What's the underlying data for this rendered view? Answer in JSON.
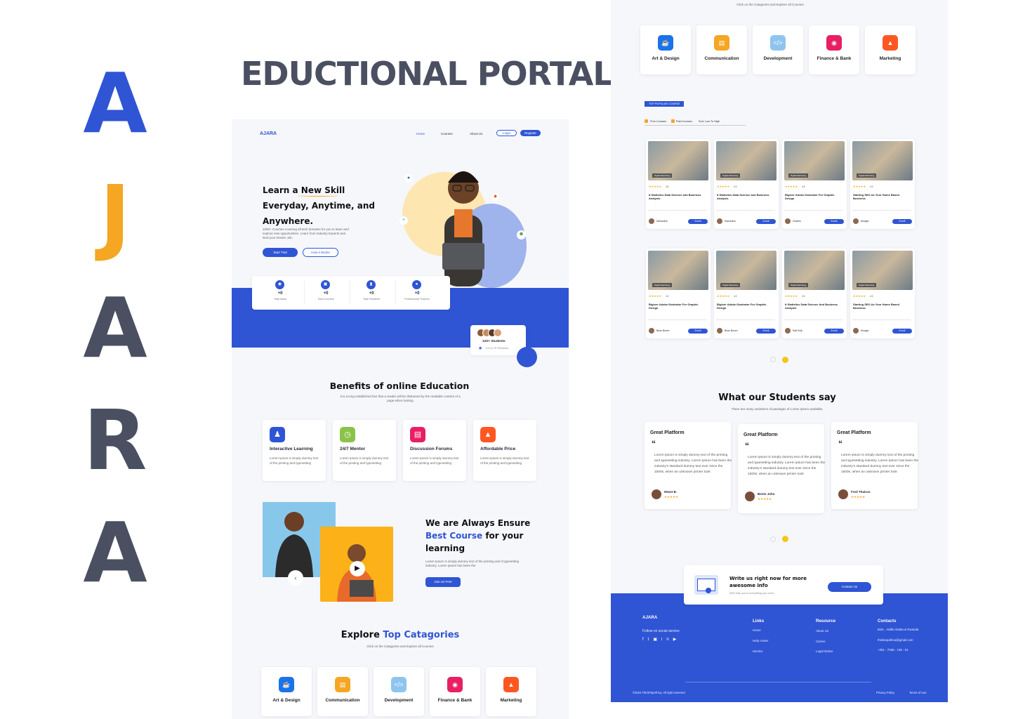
{
  "brand_letters": [
    "A",
    "J",
    "A",
    "R",
    "A"
  ],
  "page_title": "EDUCTIONAL PORTAL",
  "nav": {
    "logo": "AJARA",
    "home": "Home",
    "courses": "Courses",
    "about": "About Us",
    "login": "Login",
    "register": "Register"
  },
  "hero": {
    "headline": [
      "Learn a New Skill",
      "Everyday, Anytime, and",
      "Anywhere."
    ],
    "desc": "1000+ Courses covering all tech domains for you to learn and explore new opportunities. Learn from Industry Experts and land your Dream Job.",
    "start_trial": "Start Trial",
    "how_it_works": "How it Works",
    "stats": [
      {
        "value": "+0",
        "label": "Total Ideas"
      },
      {
        "value": "+0",
        "label": "Total Courses"
      },
      {
        "value": "+0",
        "label": "Total Students"
      },
      {
        "value": "+0",
        "label": "Professional Trainers"
      }
    ],
    "students_badge": {
      "count": "120+ Students",
      "rating": "5.0 (4.7K Reviews)"
    }
  },
  "benefits": {
    "title": "Benefits of online Education",
    "subtitle": "It is a long established fact that a reader will be distracted by the readable content of a page when looking",
    "items": [
      {
        "title": "Interactive Learning",
        "desc": "Lorem Ipsum is simply dummy text of the printing and typesetting",
        "color": "#2f55d4"
      },
      {
        "title": "24/7 Mentor",
        "desc": "Lorem Ipsum is simply dummy text of the printing and typesetting",
        "color": "#8bc34a"
      },
      {
        "title": "Discussion Forums",
        "desc": "Lorem Ipsum is simply dummy text of the printing and typesetting",
        "color": "#e91e63"
      },
      {
        "title": "Affordable Price",
        "desc": "Lorem Ipsum is simply dummy text of the printing and typesetting",
        "color": "#ff5722"
      }
    ]
  },
  "ensure": {
    "line1": "We are Always Ensure",
    "highlight": "Best Course",
    "line2": " for your",
    "line3": "learning",
    "desc": "Lorem Ipsum is simply dummy text of the printing and it typesetting industry. Lorem Ipsum has been the",
    "button": "Join Us Free"
  },
  "categories": {
    "title_a": "Explore ",
    "title_b": "Top Catagories",
    "subtitle": "Click on the Catagories and Explore all Courses",
    "items": [
      {
        "label": "Art & Design",
        "color": "#1a73e8",
        "icon": "art-icon"
      },
      {
        "label": "Communication",
        "color": "#f5a623",
        "icon": "communication-icon"
      },
      {
        "label": "Development",
        "color": "#8ec5f0",
        "icon": "code-icon"
      },
      {
        "label": "Finance & Bank",
        "color": "#e91e63",
        "icon": "finance-icon"
      },
      {
        "label": "Marketing",
        "color": "#ff5722",
        "icon": "marketing-icon"
      }
    ]
  },
  "popular": {
    "badge": "TOP POPULAR COURSE",
    "filters": [
      "Free Courses",
      "Paid Courses",
      "Sort: Low To High"
    ],
    "courses": [
      {
        "title": "It Statistics Data Science and Business Analysis",
        "author": "Samantha",
        "rating": "4.5",
        "tag": "Digital Marketing",
        "enroll": "Enroll"
      },
      {
        "title": "It Statistics Data Science and Business Analysis",
        "author": "Samantha",
        "rating": "4.5",
        "tag": "Digital Marketing",
        "enroll": "Enroll"
      },
      {
        "title": "Biginer Adobe Illustrator For Graphic Design",
        "author": "Charles",
        "rating": "4.5",
        "tag": "Digital Marketing",
        "enroll": "Enroll"
      },
      {
        "title": "Starting SEO As Your Home Based Business",
        "author": "Morgan",
        "rating": "4.5",
        "tag": "Digital Marketing",
        "enroll": "Enroll"
      },
      {
        "title": "Biginer Adobe Illustrator For Graphic Design",
        "author": "Brian Brown",
        "rating": "4.5",
        "tag": "Digital Marketing",
        "enroll": "Enroll"
      },
      {
        "title": "Biginer Adobe Illustrator For Graphic Design",
        "author": "Brian Brown",
        "rating": "4.5",
        "tag": "Digital Marketing",
        "enroll": "Enroll"
      },
      {
        "title": "It Statistics Data Science And Business Analysis",
        "author": "Ralf Kuijt",
        "rating": "4.5",
        "tag": "Digital Marketing",
        "enroll": "Enroll"
      },
      {
        "title": "Starting SEO As Your Home Based Business",
        "author": "Morgan",
        "rating": "4.5",
        "tag": "Digital Marketing",
        "enroll": "Enroll"
      }
    ]
  },
  "testimonials": {
    "title": "What our Students say",
    "subtitle": "There are many variations of passages of Lorem Ipsum available,",
    "items": [
      {
        "title": "Great Platform",
        "body": "Lorem Ipsum is simply dummy text of the printing and typesetting industry. Lorem Ipsum has been the industry's standard dummy text ever since the 1500s, when an unknown printer took",
        "name": "Hiwot B."
      },
      {
        "title": "Great Platform",
        "body": "Lorem Ipsum is simply dummy text of the printing and typesetting industry. Lorem Ipsum has been the industry's standard dummy text ever since the 1500s, when an unknown printer took",
        "name": "Benin John"
      },
      {
        "title": "Great Platform",
        "body": "Lorem Ipsum is simply dummy text of the printing and typesetting industry. Lorem Ipsum has been the industry's standard dummy text ever since the 1500s, when an unknown printer took",
        "name": "Fred Thairun"
      }
    ]
  },
  "cta": {
    "title": "Write us right now for more awesome info",
    "sub": "We'll help you in everything you need.",
    "button": "Contact Us"
  },
  "footer": {
    "logo": "AJARA",
    "follow": "Follow on social service",
    "links_title": "Links",
    "links": [
      "Home",
      "Help center",
      "Service"
    ],
    "resource_title": "Resource",
    "resources": [
      "About Us",
      "Carrier",
      "Legal Notice"
    ],
    "contacts_title": "Contacts",
    "contacts": [
      "Bole , Addis Ababa & Rwanda",
      "thinktopafrica@gmail.com",
      "+251 - 7036 - 135 - 01"
    ],
    "copyright": "©2024 ThinkTopAfrica, All right reserved",
    "privacy": "Privacy Policy",
    "terms": "Terms of Use"
  },
  "right_top_subtitle": "Click on the Catagories and Explore all Courses"
}
